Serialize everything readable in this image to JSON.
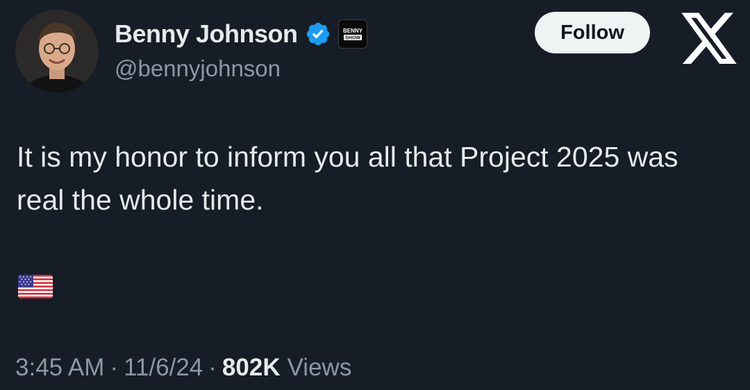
{
  "author": {
    "display_name": "Benny Johnson",
    "handle": "@bennyjohnson",
    "verified": true,
    "verified_color": "#1d9bf0",
    "affiliate_badge_text": [
      "BENNY",
      "SHOW"
    ]
  },
  "follow_button": {
    "label": "Follow"
  },
  "platform_icon": "x-logo-icon",
  "tweet": {
    "text": "It is my honor to inform you all that Project 2025 was real the whole time.",
    "emoji": "us-flag-icon"
  },
  "meta": {
    "time": "3:45 AM",
    "separator": "·",
    "date": "11/6/24",
    "view_count": "802K",
    "views_label": "Views"
  },
  "colors": {
    "background": "#161d27",
    "primary_text": "#e7e9ea",
    "secondary_text": "#8b98a5",
    "button_bg": "#eff3f4"
  }
}
